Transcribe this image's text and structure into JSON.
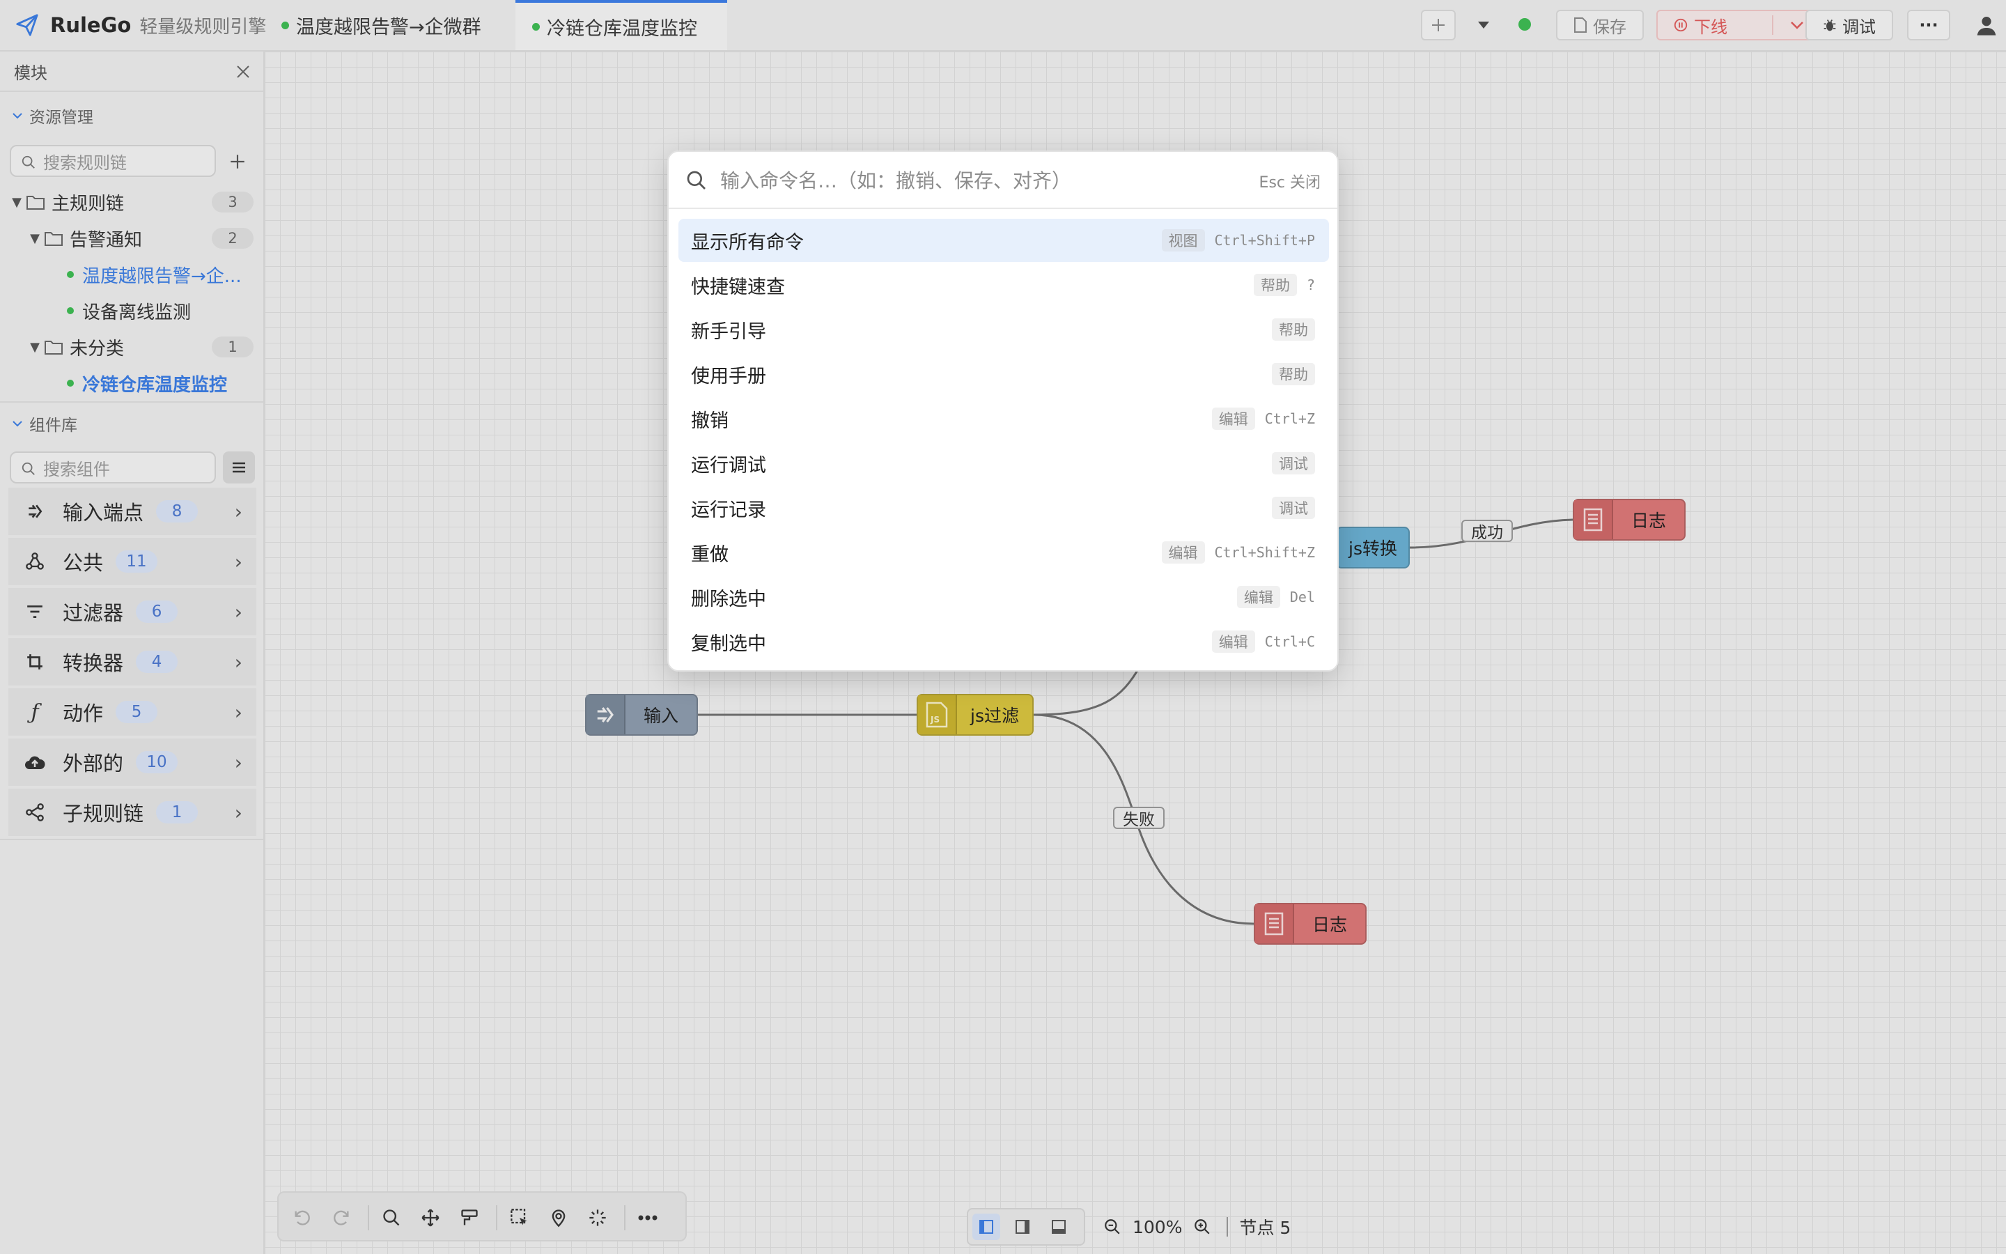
{
  "brand": {
    "name": "RuleGo",
    "subtitle": "轻量级规则引擎"
  },
  "tabs": [
    {
      "label": "温度越限告警→企微群",
      "active": false
    },
    {
      "label": "冷链仓库温度监控",
      "active": true
    }
  ],
  "toolbar": {
    "save_label": "保存",
    "offline_label": "下线",
    "debug_label": "调试",
    "more_label": "···"
  },
  "sidebar": {
    "panel_title": "模块",
    "resource_section": "资源管理",
    "chain_search_placeholder": "搜索规则链",
    "tree": [
      {
        "label": "主规则链",
        "count": "3"
      },
      {
        "label": "告警通知",
        "count": "2"
      },
      {
        "label": "温度越限告警→企...",
        "link": true
      },
      {
        "label": "设备离线监测"
      },
      {
        "label": "未分类",
        "count": "1"
      },
      {
        "label": "冷链仓库温度监控",
        "link": true,
        "active": true
      }
    ],
    "component_section": "组件库",
    "component_search_placeholder": "搜索组件",
    "categories": [
      {
        "label": "输入端点",
        "count": "8",
        "icon": "input-endpoint-icon"
      },
      {
        "label": "公共",
        "count": "11",
        "icon": "common-icon"
      },
      {
        "label": "过滤器",
        "count": "6",
        "icon": "filter-icon"
      },
      {
        "label": "转换器",
        "count": "4",
        "icon": "transform-icon"
      },
      {
        "label": "动作",
        "count": "5",
        "icon": "function-icon"
      },
      {
        "label": "外部的",
        "count": "10",
        "icon": "cloud-upload-icon"
      },
      {
        "label": "子规则链",
        "count": "1",
        "icon": "sub-chain-icon"
      }
    ]
  },
  "canvas": {
    "nodes": {
      "input": "输入",
      "js_filter": "js过滤",
      "js_transform": "js转换",
      "log_success": "日志",
      "log_failure": "日志"
    },
    "edge_labels": {
      "success": "成功",
      "failure": "失败"
    },
    "zoom": "100%",
    "node_count": "节点 5"
  },
  "palette": {
    "placeholder": "输入命令名…（如：撤销、保存、对齐）",
    "esc_hint": "Esc 关闭",
    "commands": [
      {
        "label": "显示所有命令",
        "category": "视图",
        "shortcut": "Ctrl+Shift+P",
        "selected": true
      },
      {
        "label": "快捷键速查",
        "category": "帮助",
        "shortcut": "?"
      },
      {
        "label": "新手引导",
        "category": "帮助",
        "shortcut": ""
      },
      {
        "label": "使用手册",
        "category": "帮助",
        "shortcut": ""
      },
      {
        "label": "撤销",
        "category": "编辑",
        "shortcut": "Ctrl+Z"
      },
      {
        "label": "运行调试",
        "category": "调试",
        "shortcut": ""
      },
      {
        "label": "运行记录",
        "category": "调试",
        "shortcut": ""
      },
      {
        "label": "重做",
        "category": "编辑",
        "shortcut": "Ctrl+Shift+Z"
      },
      {
        "label": "删除选中",
        "category": "编辑",
        "shortcut": "Del"
      },
      {
        "label": "复制选中",
        "category": "编辑",
        "shortcut": "Ctrl+C"
      }
    ]
  },
  "colors": {
    "accent": "#3b7de4",
    "status_online": "#3dbb52",
    "danger": "#e05a5a",
    "node_input": "#8d9cae",
    "node_filter": "#d8c43e",
    "node_transform": "#6ab0d3",
    "node_log": "#dc7777"
  }
}
